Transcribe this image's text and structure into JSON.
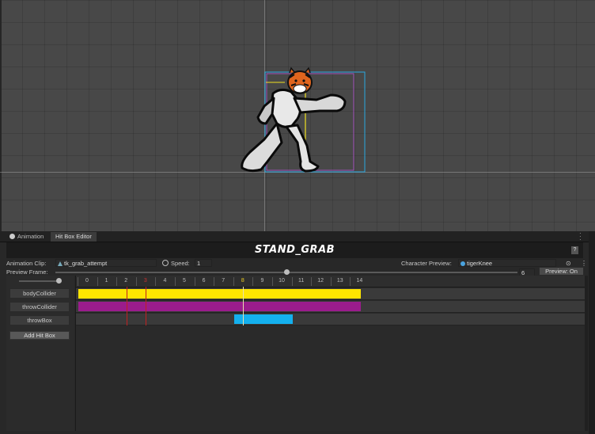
{
  "scene": {
    "character": "tiger-fighter-sprite",
    "colors": {
      "bodyBox": "#2aa8e0",
      "throwBox": "#a050b8",
      "pivotLine": "#f0e020"
    }
  },
  "tabs": [
    {
      "label": "Animation",
      "icon": "animation-icon",
      "active": false
    },
    {
      "label": "Hit Box Editor",
      "active": true
    }
  ],
  "editor": {
    "clip_title": "STAND_GRAB",
    "help_label": "?",
    "animation_clip_label": "Animation Clip:",
    "animation_clip_value": "tk_grab_attempt",
    "speed_label": "Speed:",
    "speed_value": "1",
    "character_preview_label": "Character Preview:",
    "character_preview_value": "tigerKnee",
    "preview_frame_label": "Preview Frame:",
    "preview_frame_value": "6",
    "preview_frame_fraction": 0.5,
    "preview_button": "Preview: On",
    "add_hit_box": "Add Hit Box"
  },
  "timeline": {
    "frames": [
      "0",
      "1",
      "2",
      "3",
      "4",
      "5",
      "6",
      "7",
      "8",
      "9",
      "10",
      "11",
      "12",
      "13",
      "14"
    ],
    "highlighted_frames": {
      "3": "#d03030",
      "8": "#f0d020"
    },
    "current_frame": 8,
    "red_markers": [
      2,
      3
    ],
    "tracks": [
      {
        "name": "bodyCollider",
        "color": "#ffe600",
        "start": 0,
        "end": 14.5
      },
      {
        "name": "throwCollider",
        "color": "#9b1c8c",
        "start": 0,
        "end": 14.5
      },
      {
        "name": "throwBox",
        "color": "#14b0ee",
        "start": 8,
        "end": 11
      }
    ]
  }
}
